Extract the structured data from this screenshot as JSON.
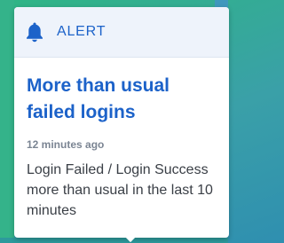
{
  "alert": {
    "label": "ALERT",
    "icon": "bell-icon",
    "title": "More than usual failed logins",
    "time": "12 minutes ago",
    "message": "Login Failed / Login Success more than usual in the last 10 minutes"
  },
  "colors": {
    "accent": "#1c62c9",
    "header_bg": "#eef3fb",
    "muted": "#7b8593",
    "text": "#3a3f46"
  }
}
